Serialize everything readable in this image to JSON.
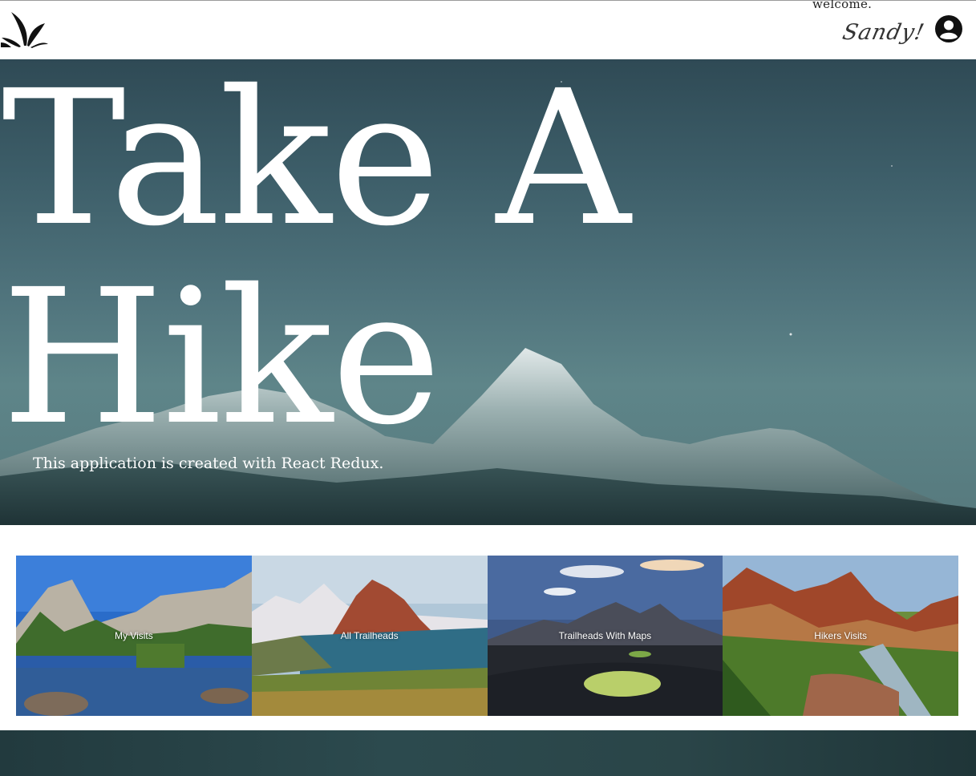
{
  "header": {
    "welcome": "welcome.",
    "username": "Sandy!",
    "icons": {
      "logo": "leaf-logo-icon",
      "account": "user-circle-icon"
    }
  },
  "hero": {
    "title_line1": "Take A",
    "title_line2": "Hike",
    "subtitle": "This application is created with React Redux."
  },
  "cards": [
    {
      "label": "My Visits"
    },
    {
      "label": "All Trailheads"
    },
    {
      "label": "Trailheads With Maps"
    },
    {
      "label": "Hikers Visits"
    }
  ],
  "colors": {
    "hero_sky": "#4f737c",
    "text_on_image": "#ffffff",
    "footer": "#2c4a4e"
  }
}
